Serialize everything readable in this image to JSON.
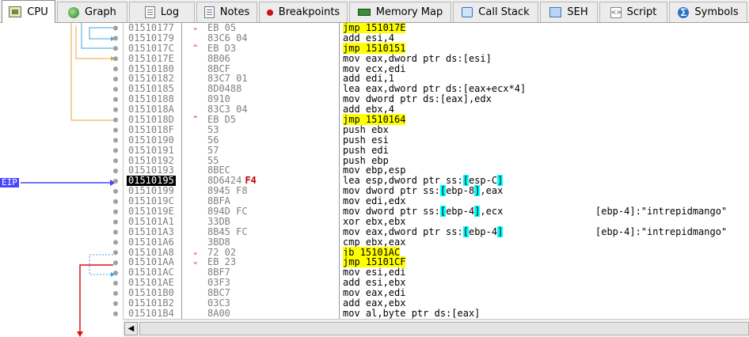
{
  "tabs": [
    {
      "label": "CPU",
      "icon": "cpu-icon",
      "active": true
    },
    {
      "label": "Graph",
      "icon": "graph-icon"
    },
    {
      "label": "Log",
      "icon": "log-icon"
    },
    {
      "label": "Notes",
      "icon": "notes-icon"
    },
    {
      "label": "Breakpoints",
      "icon": "breakpoint-icon"
    },
    {
      "label": "Memory Map",
      "icon": "memory-map-icon"
    },
    {
      "label": "Call Stack",
      "icon": "call-stack-icon"
    },
    {
      "label": "SEH",
      "icon": "seh-icon"
    },
    {
      "label": "Script",
      "icon": "script-icon"
    },
    {
      "label": "Symbols",
      "icon": "symbols-icon"
    }
  ],
  "eip_label": "EIP",
  "scroll_left_glyph": "◀",
  "colors": {
    "jump_highlight": "#ffff00",
    "bracket_highlight": "#00ffff",
    "eip_arrow": "#4646ff",
    "branch_line_orange": "#e8a33c",
    "branch_line_blue": "#3ea3e6",
    "branch_line_red": "#e01010"
  },
  "disassembly": [
    {
      "addr": "01510177",
      "marker": "⌄",
      "bytes": "EB 05",
      "mnemonic": "jmp ",
      "operand": "151017E",
      "jump": true,
      "comment": ""
    },
    {
      "addr": "01510179",
      "marker": "",
      "bytes": "83C6 04",
      "mnemonic": "add ",
      "operand": "esi,4",
      "comment": ""
    },
    {
      "addr": "0151017C",
      "marker": "^",
      "bytes": "EB D3",
      "mnemonic": "jmp ",
      "operand": "1510151",
      "jump": true,
      "comment": ""
    },
    {
      "addr": "0151017E",
      "marker": "",
      "bytes": "8B06",
      "mnemonic": "mov ",
      "operand": "eax,dword ptr ds:[esi]",
      "comment": ""
    },
    {
      "addr": "01510180",
      "marker": "",
      "bytes": "8BCF",
      "mnemonic": "mov ",
      "operand": "ecx,edi",
      "comment": ""
    },
    {
      "addr": "01510182",
      "marker": "",
      "bytes": "83C7 01",
      "mnemonic": "add ",
      "operand": "edi,1",
      "comment": ""
    },
    {
      "addr": "01510185",
      "marker": "",
      "bytes": "8D0488",
      "mnemonic": "lea ",
      "operand": "eax,dword ptr ds:[eax+ecx*4]",
      "comment": ""
    },
    {
      "addr": "01510188",
      "marker": "",
      "bytes": "8910",
      "mnemonic": "mov ",
      "operand": "dword ptr ds:[eax],edx",
      "comment": ""
    },
    {
      "addr": "0151018A",
      "marker": "",
      "bytes": "83C3 04",
      "mnemonic": "add ",
      "operand": "ebx,4",
      "comment": ""
    },
    {
      "addr": "0151018D",
      "marker": "^",
      "bytes": "EB D5",
      "mnemonic": "jmp ",
      "operand": "1510164",
      "jump": true,
      "comment": ""
    },
    {
      "addr": "0151018F",
      "marker": "",
      "bytes": "53",
      "mnemonic": "push ",
      "operand": "ebx",
      "comment": ""
    },
    {
      "addr": "01510190",
      "marker": "",
      "bytes": "56",
      "mnemonic": "push ",
      "operand": "esi",
      "comment": ""
    },
    {
      "addr": "01510191",
      "marker": "",
      "bytes": "57",
      "mnemonic": "push ",
      "operand": "edi",
      "comment": ""
    },
    {
      "addr": "01510192",
      "marker": "",
      "bytes": "55",
      "mnemonic": "push ",
      "operand": "ebp",
      "comment": ""
    },
    {
      "addr": "01510193",
      "marker": "",
      "bytes": "8BEC",
      "mnemonic": "mov ",
      "operand": "ebp,esp",
      "comment": ""
    },
    {
      "addr": "01510195",
      "marker": "",
      "bytes": "8D6424",
      "bytes_hl": "F4",
      "mnemonic": "lea ",
      "op_pre": "esp,dword ptr ss:",
      "op_br_open": "[",
      "op_mid": "esp-C",
      "op_br_close": "]",
      "op_post": "",
      "eip": true,
      "comment": ""
    },
    {
      "addr": "01510199",
      "marker": "",
      "bytes": "8945 F8",
      "mnemonic": "mov ",
      "op_pre": "dword ptr ss:",
      "op_br_open": "[",
      "op_mid": "ebp-8",
      "op_br_close": "]",
      "op_post": ",eax",
      "comment": ""
    },
    {
      "addr": "0151019C",
      "marker": "",
      "bytes": "8BFA",
      "mnemonic": "mov ",
      "operand": "edi,edx",
      "comment": ""
    },
    {
      "addr": "0151019E",
      "marker": "",
      "bytes": "894D FC",
      "mnemonic": "mov ",
      "op_pre": "dword ptr ss:",
      "op_br_open": "[",
      "op_mid": "ebp-4",
      "op_br_close": "]",
      "op_post": ",ecx",
      "comment": "[ebp-4]:\"intrepidmango\""
    },
    {
      "addr": "015101A1",
      "marker": "",
      "bytes": "33DB",
      "mnemonic": "xor ",
      "operand": "ebx,ebx",
      "comment": ""
    },
    {
      "addr": "015101A3",
      "marker": "",
      "bytes": "8B45 FC",
      "mnemonic": "mov ",
      "op_pre": "eax,dword ptr ss:",
      "op_br_open": "[",
      "op_mid": "ebp-4",
      "op_br_close": "]",
      "op_post": "",
      "comment": "[ebp-4]:\"intrepidmango\""
    },
    {
      "addr": "015101A6",
      "marker": "",
      "bytes": "3BD8",
      "mnemonic": "cmp ",
      "operand": "ebx,eax",
      "comment": ""
    },
    {
      "addr": "015101A8",
      "marker": "⌄",
      "bytes": "72 02",
      "mnemonic": "jb ",
      "operand": "15101AC",
      "jump": true,
      "comment": ""
    },
    {
      "addr": "015101AA",
      "marker": "⌄",
      "bytes": "EB 23",
      "mnemonic": "jmp ",
      "operand": "15101CF",
      "jump": true,
      "comment": ""
    },
    {
      "addr": "015101AC",
      "marker": "",
      "bytes": "8BF7",
      "mnemonic": "mov ",
      "operand": "esi,edi",
      "comment": ""
    },
    {
      "addr": "015101AE",
      "marker": "",
      "bytes": "03F3",
      "mnemonic": "add ",
      "operand": "esi,ebx",
      "comment": ""
    },
    {
      "addr": "015101B0",
      "marker": "",
      "bytes": "8BC7",
      "mnemonic": "mov ",
      "operand": "eax,edi",
      "comment": ""
    },
    {
      "addr": "015101B2",
      "marker": "",
      "bytes": "03C3",
      "mnemonic": "add ",
      "operand": "eax,ebx",
      "comment": ""
    },
    {
      "addr": "015101B4",
      "marker": "",
      "bytes": "8A00",
      "mnemonic": "mov ",
      "operand": "al,byte ptr ds:[eax]",
      "comment": ""
    }
  ]
}
